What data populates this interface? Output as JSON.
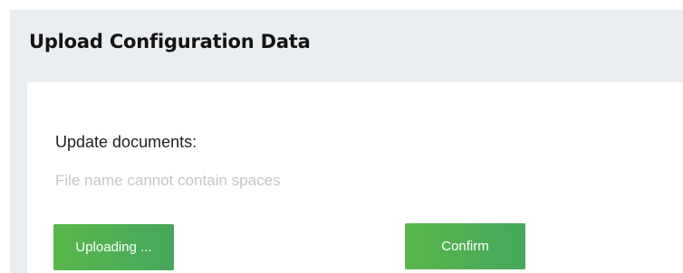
{
  "page": {
    "title": "Upload Configuration Data"
  },
  "form": {
    "label": "Update documents:",
    "hint": "File name cannot contain spaces",
    "upload_button_label": "Uploading ...",
    "confirm_button_label": "Confirm"
  },
  "colors": {
    "panel_background": "#ebeef0",
    "card_background": "#ffffff",
    "button_gradient_start": "#59b74a",
    "button_gradient_end": "#45a75d",
    "hint_text": "#c4c7cb"
  }
}
